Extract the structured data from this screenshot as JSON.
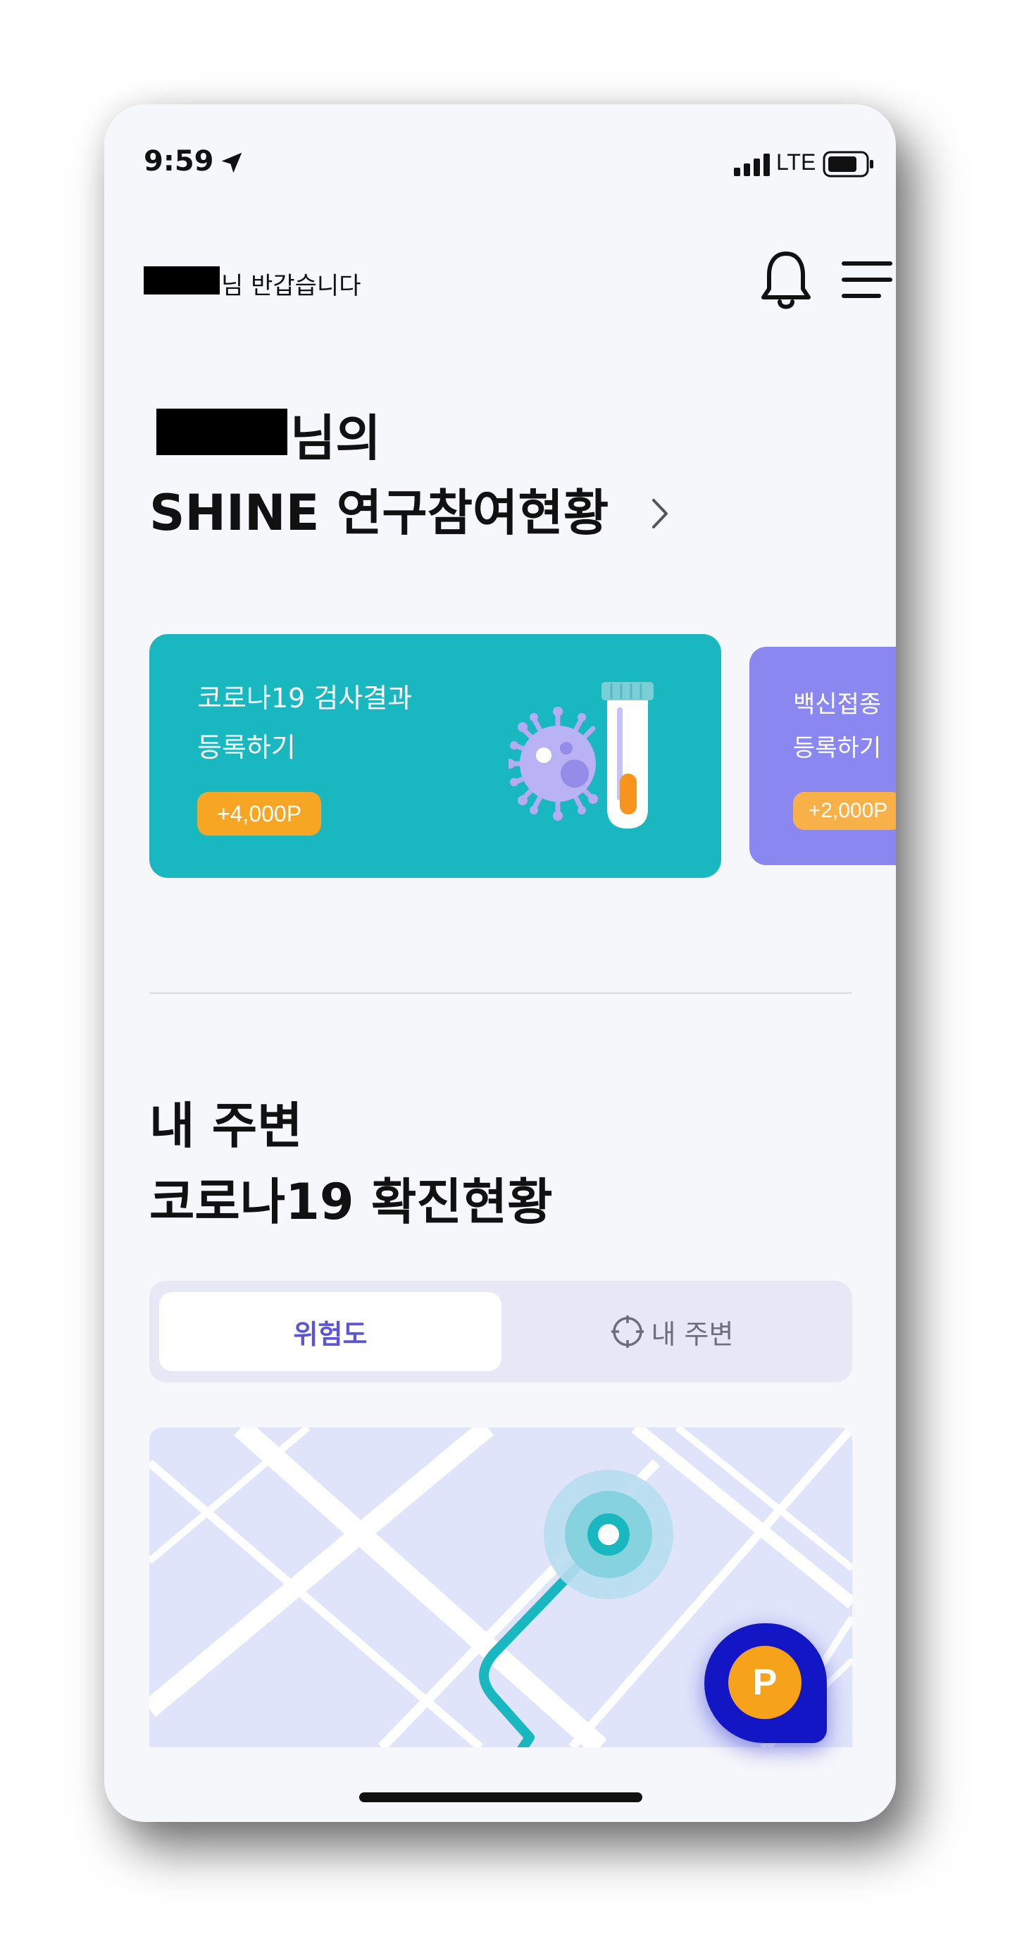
{
  "status_bar": {
    "time": "9:59",
    "network": "LTE"
  },
  "header": {
    "greeting": "님 반갑습니다",
    "icons": [
      "bell-icon",
      "menu-icon"
    ]
  },
  "study": {
    "title_suffix": "님의",
    "title_line2": "SHINE 연구참여현황"
  },
  "cards": [
    {
      "line1": "코로나19 검사결과",
      "line2": "등록하기",
      "points": "+4,000P",
      "color": "#19b8c1",
      "icon": "virus-test-tube-icon"
    },
    {
      "line1": "백신접종",
      "line2": "등록하기",
      "points": "+2,000P",
      "color": "#8a88f0"
    }
  ],
  "nearby": {
    "title_line1": "내 주변",
    "title_line2": "코로나19 확진현황",
    "tabs": [
      {
        "label": "위험도",
        "active": true
      },
      {
        "label": "내 주변",
        "active": false,
        "icon": "crosshair-icon"
      }
    ]
  },
  "fab": {
    "label": "P",
    "color": "#1316c4"
  },
  "colors": {
    "accent": "#5b54d6",
    "badge": "#f7a623",
    "teal": "#19b8c1"
  }
}
